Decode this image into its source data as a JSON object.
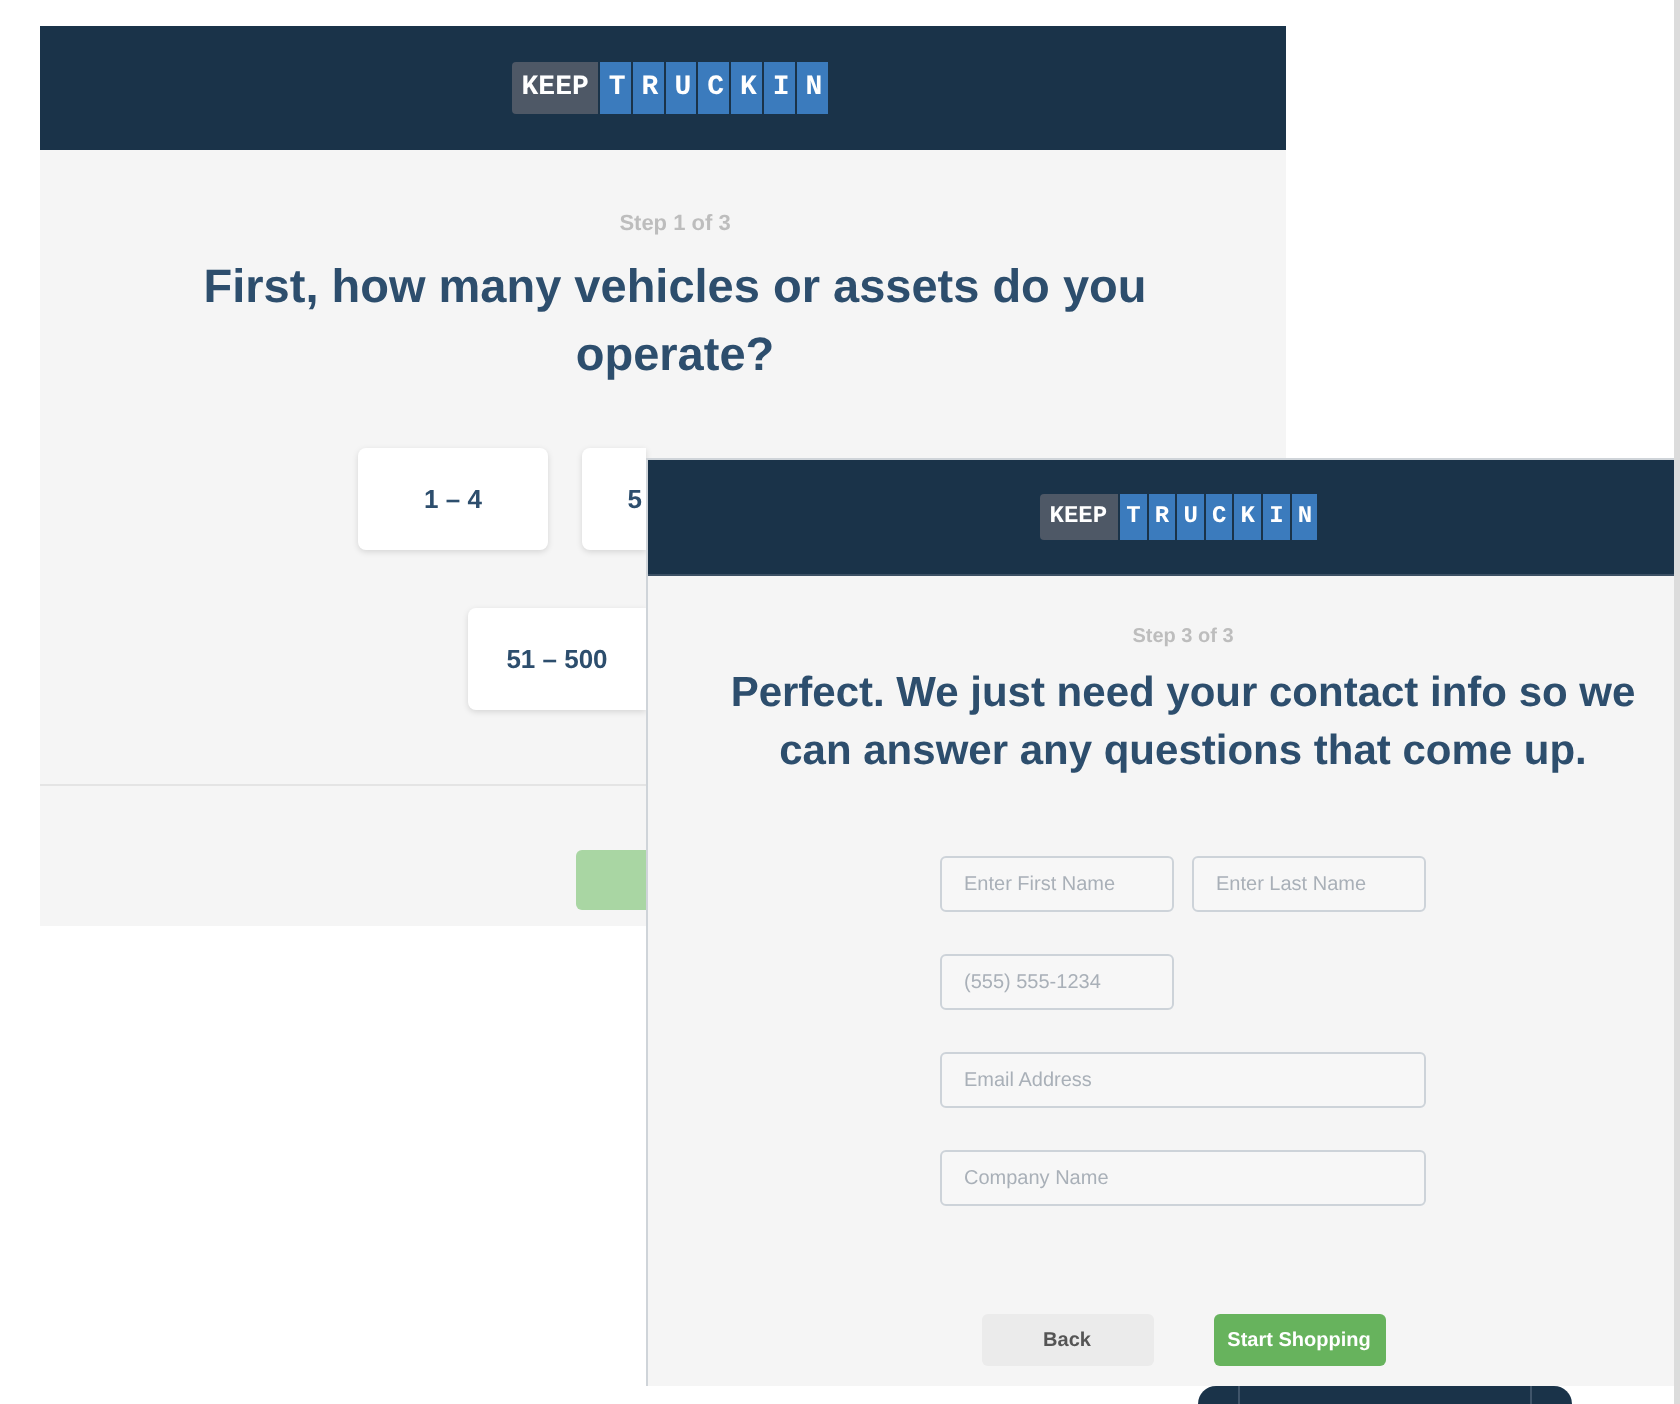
{
  "back_screen": {
    "logo": {
      "prefix": "KEEP",
      "name": "TRUCKIN"
    },
    "step": "Step 1 of 3",
    "heading": "First, how many vehicles or assets do you operate?",
    "option_rows": [
      [
        {
          "label": "1 – 4",
          "kind": "full"
        },
        {
          "label": "5",
          "kind": "partial"
        }
      ],
      [
        {
          "label": "51 – 500",
          "kind": "trimmed"
        }
      ]
    ],
    "next_button": {
      "kind": "primary"
    }
  },
  "front_screen": {
    "logo": {
      "prefix": "KEEP",
      "name": "TRUCKIN"
    },
    "step": "Step 3 of 3",
    "heading": "Perfect. We just need your contact info so we can answer any questions that come up.",
    "field_rows": [
      [
        {
          "placeholder": "Enter First Name",
          "kind": "short"
        },
        {
          "placeholder": "Enter Last Name",
          "kind": "short"
        }
      ],
      [
        {
          "placeholder": "(555) 555-1234",
          "kind": "short"
        }
      ],
      [
        {
          "placeholder": "Email Address",
          "kind": "wide"
        }
      ],
      [
        {
          "placeholder": "Company Name",
          "kind": "wide"
        }
      ]
    ],
    "buttons": [
      {
        "label": "Back",
        "kind": "secondary"
      },
      {
        "label": "Start Shopping",
        "kind": "primary"
      }
    ]
  }
}
